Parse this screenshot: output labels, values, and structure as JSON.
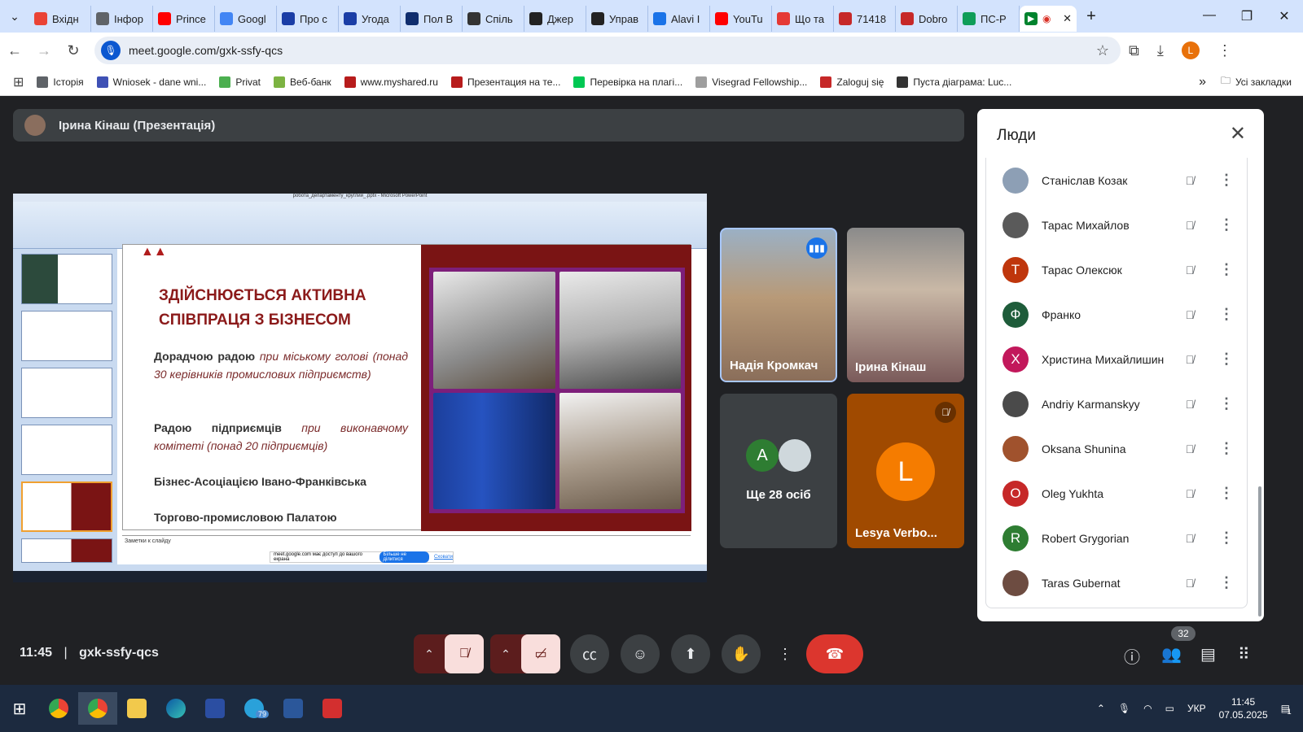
{
  "browser": {
    "tabs": [
      {
        "label": "Вхідн",
        "color": "#ea4335"
      },
      {
        "label": "Інфор",
        "color": "#5f6368"
      },
      {
        "label": "Prince",
        "color": "#ff0000"
      },
      {
        "label": "Googl",
        "color": "#4285f4"
      },
      {
        "label": "Про с",
        "color": "#1a3da6"
      },
      {
        "label": "Угода",
        "color": "#1a3da6"
      },
      {
        "label": "Пол В",
        "color": "#0f2d6e"
      },
      {
        "label": "Спіль",
        "color": "#333333"
      },
      {
        "label": "Джер",
        "color": "#222222"
      },
      {
        "label": "Управ",
        "color": "#222222"
      },
      {
        "label": "Alavi I",
        "color": "#1a73e8"
      },
      {
        "label": "YouTu",
        "color": "#ff0000"
      },
      {
        "label": "Що та",
        "color": "#e53935"
      },
      {
        "label": "71418",
        "color": "#c62828"
      },
      {
        "label": "Dobro",
        "color": "#c62828"
      },
      {
        "label": "ПС-Р",
        "color": "#0f9d58"
      }
    ],
    "new_tab": "+",
    "address": "meet.google.com/gxk-ssfy-qcs",
    "profile_initial": "L",
    "bookmarks": [
      {
        "label": "Історія",
        "color": "#5f6368"
      },
      {
        "label": "Wniosek - dane wni...",
        "color": "#3f51b5"
      },
      {
        "label": "Privat",
        "color": "#4caf50"
      },
      {
        "label": "Веб-банк",
        "color": "#7cb342"
      },
      {
        "label": "www.myshared.ru",
        "color": "#b71c1c"
      },
      {
        "label": "Презентация на те...",
        "color": "#b71c1c"
      },
      {
        "label": "Перевірка на плагі...",
        "color": "#00c853"
      },
      {
        "label": "Visegrad Fellowship...",
        "color": "#9e9e9e"
      },
      {
        "label": "Zaloguj się",
        "color": "#c62828"
      },
      {
        "label": "Пуста діаграма: Luc...",
        "color": "#333333"
      }
    ],
    "all_bookmarks": "Усі закладки"
  },
  "meet": {
    "presenter_bar": "Ірина Кінаш (Презентація)",
    "slide": {
      "title": "ЗДІЙСНЮЄТЬСЯ АКТИВНА СПІВПРАЦЯ З БІЗНЕСОМ",
      "p1_bold": "Дорадчою радою",
      "p1_rest": " при міському голові (понад 30 керівників промислових підприємств)",
      "p2_bold": "Радою підприємців",
      "p2_rest": " при виконавчому комітеті (понад 20 підприємців)",
      "p3": "Бізнес-Асоціацією Івано-Франківська",
      "p4": "Торгово-промисловою Палатою",
      "notes": "Заметки к слайду",
      "share_text": "meet.google.com має доступ до вашого екрана",
      "share_stop": "Більше не ділитися",
      "share_hide": "Сховати",
      "window_title": "робота_департаменту_круглий_.pptx - Microsoft PowerPoint"
    },
    "tiles": [
      {
        "name": "Надія Кромкач"
      },
      {
        "name": "Ірина Кінаш"
      },
      {
        "name": "Ще 28 осіб",
        "avatar_letter": "A"
      },
      {
        "name": "Lesya Verbo...",
        "avatar_letter": "L"
      }
    ],
    "panel": {
      "title": "Люди",
      "people": [
        {
          "name": "Станіслав Козак",
          "letter": "",
          "color": "#8d9fb5"
        },
        {
          "name": "Тарас Михайлов",
          "letter": "",
          "color": "#5a5a5a"
        },
        {
          "name": "Тарас Олексюк",
          "letter": "Т",
          "color": "#bf360c"
        },
        {
          "name": "Франко",
          "letter": "Ф",
          "color": "#1e5c3a"
        },
        {
          "name": "Христина Михайлишин",
          "letter": "Х",
          "color": "#c2185b"
        },
        {
          "name": "Andriy Karmanskyy",
          "letter": "",
          "color": "#4a4a4a"
        },
        {
          "name": "Oksana Shunina",
          "letter": "",
          "color": "#a0522d"
        },
        {
          "name": "Oleg Yukhta",
          "letter": "O",
          "color": "#c62828"
        },
        {
          "name": "Robert Grygorian",
          "letter": "R",
          "color": "#2e7d32"
        },
        {
          "name": "Taras Gubernat",
          "letter": "",
          "color": "#6d4c41"
        }
      ]
    },
    "bottom": {
      "time": "11:45",
      "separator": "|",
      "meeting_code": "gxk-ssfy-qcs",
      "people_count": "32"
    }
  },
  "taskbar": {
    "lang": "УКР",
    "time": "11:45",
    "date": "07.05.2025",
    "telegram_badge": "79",
    "notif_count": "1"
  }
}
